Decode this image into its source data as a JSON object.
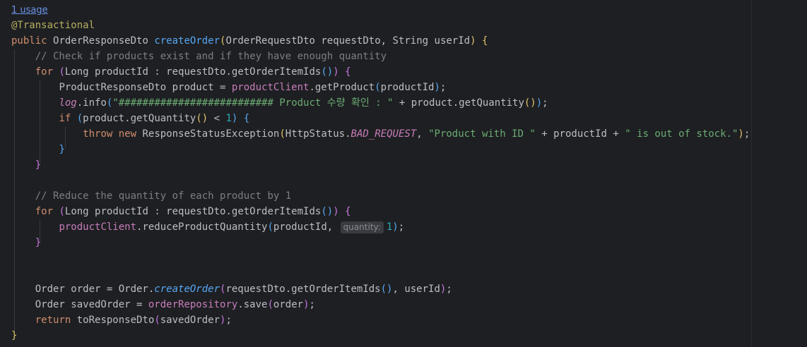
{
  "usage": "1 usage",
  "annotation": "@Transactional",
  "sig": {
    "kw_public": "public",
    "ret_type": "OrderResponseDto",
    "method": "createOrder",
    "param1_type": "OrderRequestDto",
    "param1": "requestDto",
    "param2_type": "String",
    "param2": "userId"
  },
  "comment1": "// Check if products exist and if they have enough quantity",
  "for_kw": "for",
  "for_decl": "Long productId : requestDto.getOrderItemIds",
  "l6": {
    "decl": "ProductResponseDto product = ",
    "field": "productClient",
    "call": ".getProduct",
    "arg": "productId"
  },
  "l7": {
    "log": "log",
    "info": ".info",
    "string": "\"########################## Product 수량 확인 : \"",
    "rest": " + product.getQuantity"
  },
  "l8": {
    "kw": "if",
    "cond": "product.getQuantity",
    "op": " < ",
    "num": "1"
  },
  "l9": {
    "kw_throw": "throw",
    "kw_new": "new",
    "cls": "ResponseStatusException",
    "status_cls": "HttpStatus.",
    "status_const": "BAD_REQUEST",
    "str1": "\"Product with ID \"",
    "mid": " + productId + ",
    "str2": "\" is out of stock.\""
  },
  "comment2": "// Reduce the quantity of each product by 1",
  "l15": {
    "field": "productClient",
    "call": ".reduceProductQuantity",
    "arg": "productId, ",
    "hint": "quantity:",
    "num": "1"
  },
  "l19": {
    "decl": "Order order = Order.",
    "call": "createOrder",
    "arg": "requestDto.getOrderItemIds",
    "rest": ", userId"
  },
  "l20": {
    "decl": "Order savedOrder = ",
    "field": "orderRepository",
    "call": ".save",
    "arg": "order"
  },
  "l21": {
    "kw": "return",
    "call": " toResponseDto",
    "arg": "savedOrder"
  },
  "colors": {
    "background": "#1e1f22",
    "keyword": "#cf8e6d",
    "function": "#56a8f5",
    "string": "#6aab73",
    "number": "#2aacb8",
    "field": "#c77dbb",
    "comment": "#7a7e85",
    "annotation": "#b3ae60"
  }
}
